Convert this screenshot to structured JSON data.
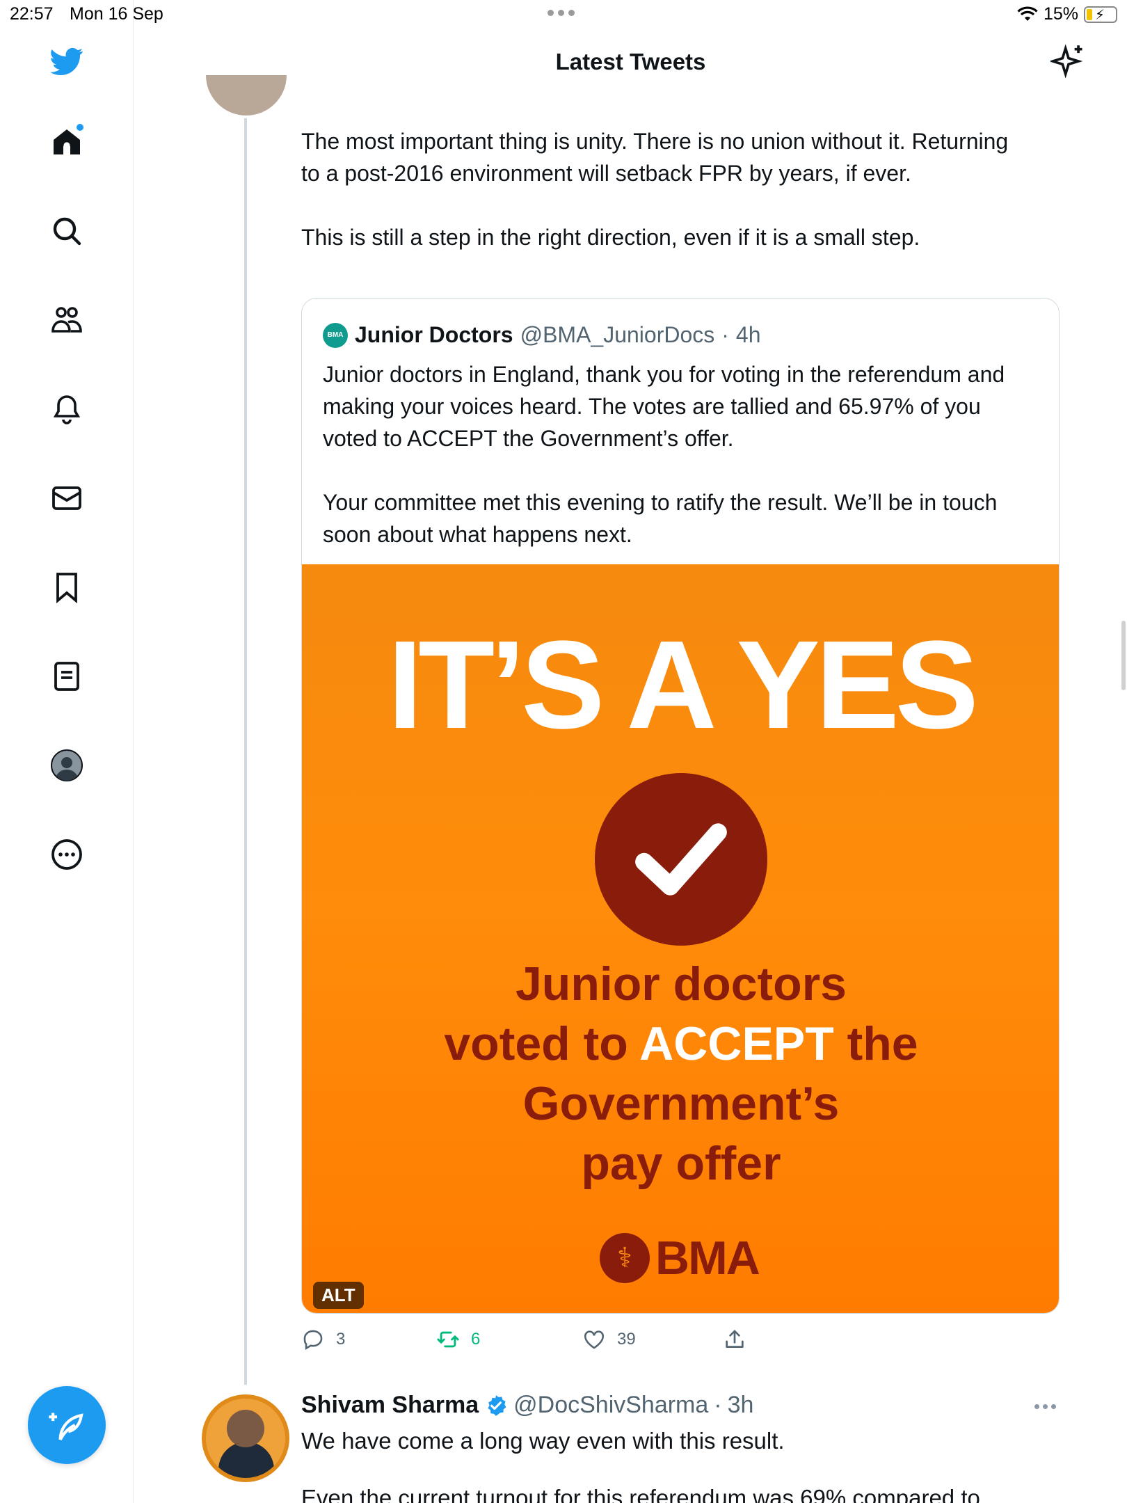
{
  "status_bar": {
    "time": "22:57",
    "date": "Mon 16 Sep",
    "battery": "15%"
  },
  "header": {
    "title": "Latest Tweets"
  },
  "sidebar": {
    "items": [
      {
        "name": "home",
        "icon": "home-icon"
      },
      {
        "name": "explore",
        "icon": "search-icon"
      },
      {
        "name": "communities",
        "icon": "communities-icon"
      },
      {
        "name": "notifications",
        "icon": "bell-icon"
      },
      {
        "name": "messages",
        "icon": "envelope-icon"
      },
      {
        "name": "bookmarks",
        "icon": "bookmark-icon"
      },
      {
        "name": "lists",
        "icon": "list-icon"
      },
      {
        "name": "profile",
        "icon": "profile-icon"
      },
      {
        "name": "more",
        "icon": "more-icon"
      }
    ]
  },
  "tweet": {
    "text": "The most important thing is unity. There is no union without it. Returning to a post-2016 environment will setback FPR by years, if ever.\n\nThis is still a step in the right direction, even if it is a small step.",
    "quote": {
      "logo_text": "BMA",
      "name": "Junior Doctors",
      "handle": "@BMA_JuniorDocs",
      "time": "4h",
      "text": "Junior doctors in England, thank you for voting in the referendum and making your voices heard. The votes are tallied and 65.97% of you voted to ACCEPT the Government’s offer.\n\nYour committee met this evening to ratify the result. We’ll be in touch soon about what happens next.",
      "image": {
        "headline": "IT’S A YES",
        "sub_line1": "Junior doctors",
        "sub_line2_pre": "voted to ",
        "sub_line2_accent": "ACCEPT",
        "sub_line2_post": " the",
        "sub_line3": "Government’s",
        "sub_line4": "pay offer",
        "logo": "BMA",
        "alt_label": "ALT"
      }
    },
    "actions": {
      "replies": "3",
      "retweets": "6",
      "likes": "39"
    }
  },
  "next_tweet": {
    "name": "Shivam Sharma",
    "handle": "@DocShivSharma",
    "time": "3h",
    "text": "We have come a long way even with this result.",
    "cut_text": "Even the current turnout for this referendum was 69% compared to"
  },
  "colors": {
    "accent": "#1d9bf0",
    "retweet": "#00ba7c",
    "bma_orange": "#ff8c0a",
    "bma_dark": "#8a1c0c"
  }
}
